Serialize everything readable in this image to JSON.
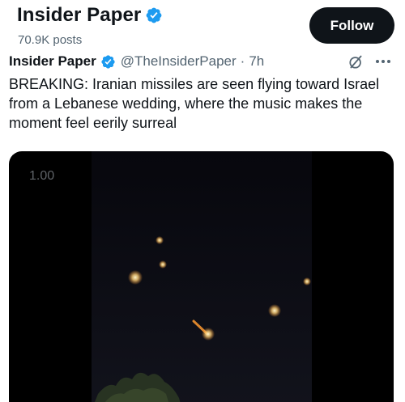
{
  "profile": {
    "name": "Insider Paper",
    "post_count": "70.9K posts",
    "follow_label": "Follow"
  },
  "tweet": {
    "author": "Insider Paper",
    "handle": "@TheInsiderPaper",
    "separator": "·",
    "time": "7h",
    "text": "BREAKING: Iranian missiles are seen flying toward Israel from a Lebanese wedding, where the music makes the moment feel eerily surreal"
  },
  "media": {
    "playback_speed": "1.00"
  },
  "colors": {
    "verified_blue": "#1d9bf0",
    "follow_bg": "#0f1419",
    "muted_text": "#536471"
  },
  "icons": {
    "verified": "verified-badge-icon",
    "grok": "grok-icon",
    "more": "more-options-icon"
  }
}
